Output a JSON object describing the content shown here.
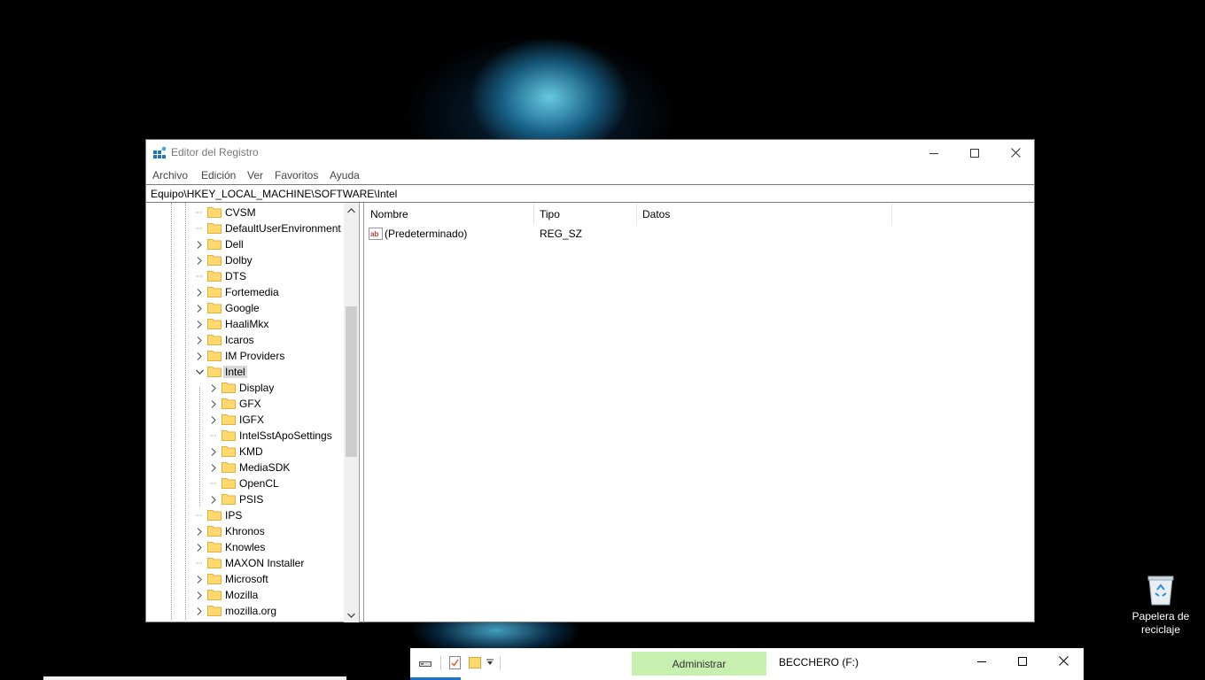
{
  "regedit": {
    "title": "Editor del Registro",
    "menu": [
      "Archivo",
      "Edición",
      "Ver",
      "Favoritos",
      "Ayuda"
    ],
    "address": "Equipo\\HKEY_LOCAL_MACHINE\\SOFTWARE\\Intel",
    "tree": [
      {
        "label": "CVSM",
        "level": 0,
        "expander": "none"
      },
      {
        "label": "DefaultUserEnvironment",
        "level": 0,
        "expander": "none"
      },
      {
        "label": "Dell",
        "level": 0,
        "expander": "collapsed"
      },
      {
        "label": "Dolby",
        "level": 0,
        "expander": "collapsed"
      },
      {
        "label": "DTS",
        "level": 0,
        "expander": "none"
      },
      {
        "label": "Fortemedia",
        "level": 0,
        "expander": "collapsed"
      },
      {
        "label": "Google",
        "level": 0,
        "expander": "collapsed"
      },
      {
        "label": "HaaliMkx",
        "level": 0,
        "expander": "collapsed"
      },
      {
        "label": "Icaros",
        "level": 0,
        "expander": "collapsed"
      },
      {
        "label": "IM Providers",
        "level": 0,
        "expander": "collapsed"
      },
      {
        "label": "Intel",
        "level": 0,
        "expander": "expanded",
        "selected": true
      },
      {
        "label": "Display",
        "level": 1,
        "expander": "collapsed"
      },
      {
        "label": "GFX",
        "level": 1,
        "expander": "collapsed"
      },
      {
        "label": "IGFX",
        "level": 1,
        "expander": "collapsed"
      },
      {
        "label": "IntelSstApoSettings",
        "level": 1,
        "expander": "none"
      },
      {
        "label": "KMD",
        "level": 1,
        "expander": "collapsed"
      },
      {
        "label": "MediaSDK",
        "level": 1,
        "expander": "collapsed"
      },
      {
        "label": "OpenCL",
        "level": 1,
        "expander": "none"
      },
      {
        "label": "PSIS",
        "level": 1,
        "expander": "collapsed"
      },
      {
        "label": "IPS",
        "level": 0,
        "expander": "none"
      },
      {
        "label": "Khronos",
        "level": 0,
        "expander": "collapsed"
      },
      {
        "label": "Knowles",
        "level": 0,
        "expander": "collapsed"
      },
      {
        "label": "MAXON Installer",
        "level": 0,
        "expander": "none"
      },
      {
        "label": "Microsoft",
        "level": 0,
        "expander": "collapsed"
      },
      {
        "label": "Mozilla",
        "level": 0,
        "expander": "collapsed"
      },
      {
        "label": "mozilla.org",
        "level": 0,
        "expander": "collapsed"
      }
    ],
    "columns": {
      "name": "Nombre",
      "type": "Tipo",
      "data": "Datos"
    },
    "values": [
      {
        "name": "(Predeterminado)",
        "type": "REG_SZ",
        "data": ""
      }
    ]
  },
  "desktop": {
    "recycle_bin_label": "Papelera de reciclaje"
  },
  "explorer": {
    "context_tab": "Administrar",
    "title": "BECCHERO (F:)"
  },
  "colors": {
    "selection": "#d9d9d9",
    "context_tab": "#c6efb0",
    "folder": "#ffd86e",
    "wallpaper_glow": "#5fd6ff"
  }
}
